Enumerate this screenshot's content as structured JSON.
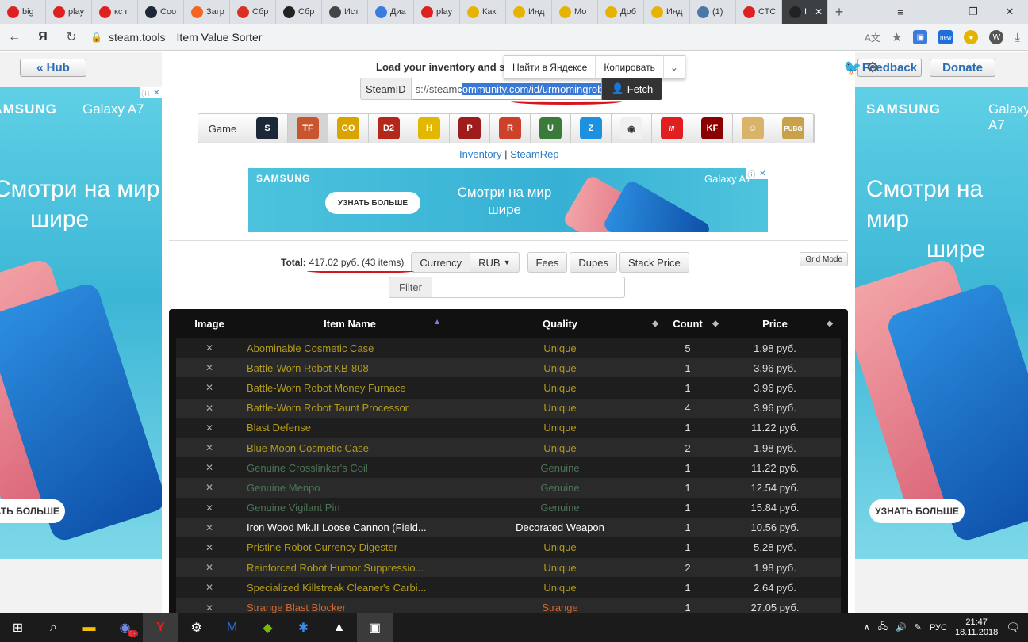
{
  "browser": {
    "tabs": [
      {
        "label": "big",
        "icon": "yandex-icon",
        "color": "#e02020"
      },
      {
        "label": "play",
        "icon": "yandex-icon",
        "color": "#e02020"
      },
      {
        "label": "кс г",
        "icon": "yandex-icon",
        "color": "#e02020"
      },
      {
        "label": "Соо",
        "icon": "steam-icon",
        "color": "#1b2838"
      },
      {
        "label": "Загр",
        "icon": "download-icon",
        "color": "#f26522"
      },
      {
        "label": "Сбр",
        "icon": "gmail-icon",
        "color": "#d93025"
      },
      {
        "label": "Сбр",
        "icon": "ea-icon",
        "color": "#222222"
      },
      {
        "label": "Ист",
        "icon": "clock-icon",
        "color": "#444444"
      },
      {
        "label": "Диа",
        "icon": "chat-icon",
        "color": "#3a7be0"
      },
      {
        "label": "play",
        "icon": "yandex-icon",
        "color": "#e02020"
      },
      {
        "label": "Как",
        "icon": "coin-icon",
        "color": "#e6b400"
      },
      {
        "label": "Инд",
        "icon": "coin-icon",
        "color": "#e6b400"
      },
      {
        "label": "Мо",
        "icon": "coin-icon",
        "color": "#e6b400"
      },
      {
        "label": "Доб",
        "icon": "coin-icon",
        "color": "#e6b400"
      },
      {
        "label": "Инд",
        "icon": "coin-icon",
        "color": "#e6b400"
      },
      {
        "label": "(1)",
        "icon": "vk-icon",
        "color": "#4a76a8"
      },
      {
        "label": "СТС",
        "icon": "yandex-icon",
        "color": "#e02020"
      },
      {
        "label": "I",
        "icon": "steamtools-icon",
        "color": "#222222",
        "active": true
      }
    ],
    "address": {
      "host": "steam.tools",
      "title": "Item Value Sorter"
    }
  },
  "header": {
    "hub_button": "« Hub",
    "feedback_button": "Feedback",
    "donate_button": "Donate",
    "load_title": "Load your inventory and so",
    "context_menu": {
      "search": "Найти в Яндексе",
      "copy": "Копировать"
    },
    "steamid_label": "SteamID",
    "steamid_plain": "s://steamc",
    "steamid_selected": "ommunity.com/id/urmomingrob/",
    "fetch_button": "Fetch"
  },
  "games": {
    "label": "Game",
    "items": [
      {
        "name": "steam",
        "color": "#1b2838",
        "glyph": "S"
      },
      {
        "name": "tf2",
        "color": "#c8552d",
        "glyph": "TF",
        "active": true
      },
      {
        "name": "csgo",
        "color": "#d9a400",
        "glyph": "GO"
      },
      {
        "name": "dota2",
        "color": "#b4281c",
        "glyph": "D2"
      },
      {
        "name": "h1z1",
        "color": "#e2b700",
        "glyph": "H"
      },
      {
        "name": "payday",
        "color": "#9e1c1c",
        "glyph": "P"
      },
      {
        "name": "rust",
        "color": "#cd412b",
        "glyph": "R"
      },
      {
        "name": "unturned",
        "color": "#3a7a3a",
        "glyph": "U"
      },
      {
        "name": "z",
        "color": "#1e90e0",
        "glyph": "Z"
      },
      {
        "name": "game-10",
        "color": "#f0f0f0",
        "glyph": "◉"
      },
      {
        "name": "killing-floor",
        "color": "#e02020",
        "glyph": "///"
      },
      {
        "name": "kf2",
        "color": "#8b0000",
        "glyph": "KF"
      },
      {
        "name": "game-13",
        "color": "#d9b36a",
        "glyph": "☺"
      },
      {
        "name": "pubg",
        "color": "#c8a24a",
        "glyph": "PUBG"
      }
    ]
  },
  "links": {
    "inventory": "Inventory",
    "separator": "|",
    "steamrep": "SteamRep"
  },
  "ads": {
    "brand": "SAMSUNG",
    "model": "Galaxy A7",
    "headline_line1": "Смотри на мир",
    "headline_line2": "шире",
    "cta": "УЗНАТЬ БОЛЬШЕ",
    "center_brand": "SAMSUNG",
    "center_model": "Galaxy A7",
    "center_head": "Смотри на мир шире",
    "center_cta": "УЗНАТЬ БОЛЬШЕ"
  },
  "summary": {
    "total_label": "Total:",
    "total_value": "417.02 руб. (43 items)",
    "currency_label": "Currency",
    "currency_value": "RUB",
    "fees": "Fees",
    "dupes": "Dupes",
    "stack_price": "Stack Price",
    "grid_mode": "Grid Mode",
    "filter_label": "Filter"
  },
  "table": {
    "headers": {
      "image": "Image",
      "name": "Item Name",
      "quality": "Quality",
      "count": "Count",
      "price": "Price"
    },
    "quality_colors": {
      "Unique": "#b39c1b",
      "Genuine": "#4d7455",
      "Decorated Weapon": "#ffffff",
      "Strange": "#cf6a32"
    },
    "rows": [
      {
        "name": "Abominable Cosmetic Case",
        "quality": "Unique",
        "count": "5",
        "price": "1.98 руб."
      },
      {
        "name": "Battle-Worn Robot KB-808",
        "quality": "Unique",
        "count": "1",
        "price": "3.96 руб."
      },
      {
        "name": "Battle-Worn Robot Money Furnace",
        "quality": "Unique",
        "count": "1",
        "price": "3.96 руб."
      },
      {
        "name": "Battle-Worn Robot Taunt Processor",
        "quality": "Unique",
        "count": "4",
        "price": "3.96 руб."
      },
      {
        "name": "Blast Defense",
        "quality": "Unique",
        "count": "1",
        "price": "11.22 руб."
      },
      {
        "name": "Blue Moon Cosmetic Case",
        "quality": "Unique",
        "count": "2",
        "price": "1.98 руб."
      },
      {
        "name": "Genuine Crosslinker's Coil",
        "quality": "Genuine",
        "count": "1",
        "price": "11.22 руб."
      },
      {
        "name": "Genuine Menpo",
        "quality": "Genuine",
        "count": "1",
        "price": "12.54 руб."
      },
      {
        "name": "Genuine Vigilant Pin",
        "quality": "Genuine",
        "count": "1",
        "price": "15.84 руб."
      },
      {
        "name": "Iron Wood Mk.II Loose Cannon (Field...",
        "quality": "Decorated Weapon",
        "count": "1",
        "price": "10.56 руб."
      },
      {
        "name": "Pristine Robot Currency Digester",
        "quality": "Unique",
        "count": "1",
        "price": "5.28 руб."
      },
      {
        "name": "Reinforced Robot Humor Suppressio...",
        "quality": "Unique",
        "count": "2",
        "price": "1.98 руб."
      },
      {
        "name": "Specialized Killstreak Cleaner's Carbi...",
        "quality": "Unique",
        "count": "1",
        "price": "2.64 руб."
      },
      {
        "name": "Strange Blast Blocker",
        "quality": "Strange",
        "count": "1",
        "price": "27.05 руб."
      }
    ]
  },
  "taskbar": {
    "lang": "РУС",
    "time": "21:47",
    "date": "18.11.2018",
    "badge": "9+"
  }
}
